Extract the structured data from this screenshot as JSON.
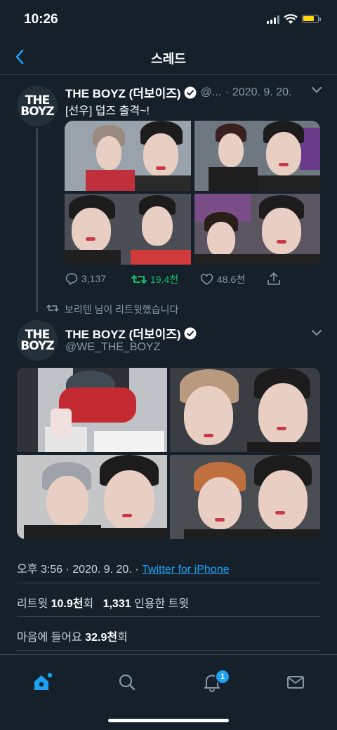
{
  "status_bar": {
    "time": "10:26"
  },
  "header": {
    "title": "스레드"
  },
  "tweet1": {
    "avatar_text": "THE\nBOYZ",
    "display_name": "THE BOYZ (더보이즈)",
    "handle_truncated": "@...",
    "date": "· 2020. 9. 20.",
    "text": "[선우] 덥즈 출격~!",
    "reply_count": "3,137",
    "retweet_count": "19.4천",
    "like_count": "48.6천"
  },
  "retweet_context": "보리텐 님이 리트윗했습니다",
  "tweet2": {
    "avatar_text": "THE\nBOYZ",
    "display_name": "THE BOYZ (더보이즈)",
    "handle": "@WE_THE_BOYZ",
    "time_date": "오후 3:56 · 2020. 9. 20. ·",
    "source": "Twitter for iPhone",
    "retweets_label": "리트윗",
    "retweets_value": "10.9천",
    "retweets_unit": "회",
    "quotes_value": "1,331",
    "quotes_label": "인용한 트윗",
    "likes_label": "마음에 들어요",
    "likes_value": "32.9천",
    "likes_unit": "회"
  },
  "tabbar": {
    "notification_badge": "1"
  },
  "colors": {
    "background": "#15202b",
    "accent": "#1da1f2",
    "retweet_green": "#17bf63",
    "muted": "#8899a6"
  }
}
